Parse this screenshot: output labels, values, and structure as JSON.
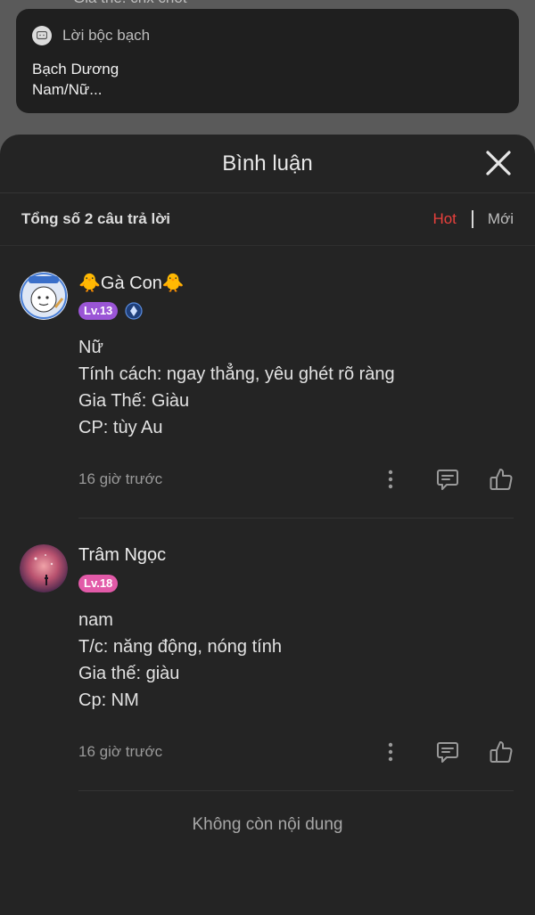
{
  "background_peek": "Gia thế: chx chốt",
  "card": {
    "title": "Lời bộc bạch",
    "line1": "Bạch Dương",
    "line2": "Nam/Nữ..."
  },
  "sheet": {
    "title": "Bình luận",
    "total_label": "Tổng số 2 câu trả lời",
    "sort_hot": "Hot",
    "sort_new": "Mới"
  },
  "comments": [
    {
      "name": "🐥Gà Con🐥",
      "level": "Lv.13",
      "lines": [
        "Nữ",
        "Tính cách: ngay thẳng, yêu ghét rõ ràng",
        "Gia Thế: Giàu",
        "CP: tùy Au"
      ],
      "time": "16 giờ trước"
    },
    {
      "name": "Trâm Ngọc",
      "level": "Lv.18",
      "lines": [
        "nam",
        "T/c: năng động, nóng tính",
        "Gia thế: giàu",
        "Cp: NM"
      ],
      "time": "16 giờ trước"
    }
  ],
  "end_text": "Không còn nội dung",
  "colors": {
    "accent_hot": "#e8403c",
    "level_purple": "#9a55d6",
    "level_pink": "#e25aa8"
  }
}
